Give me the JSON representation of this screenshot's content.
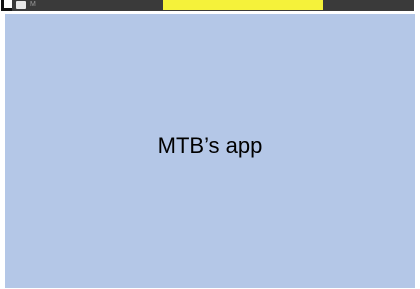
{
  "window": {
    "tab_left_1": "M",
    "tab_left_2": "",
    "highlight_tab": "",
    "right_text": ""
  },
  "app": {
    "title": "MTB’s app"
  },
  "colors": {
    "surface": "#b4c7e7",
    "topbar": "#3a3a3a",
    "highlight": "#f5f23a"
  },
  "icons": {
    "corner": "corner-bracket-icon",
    "app": "app-icon"
  }
}
